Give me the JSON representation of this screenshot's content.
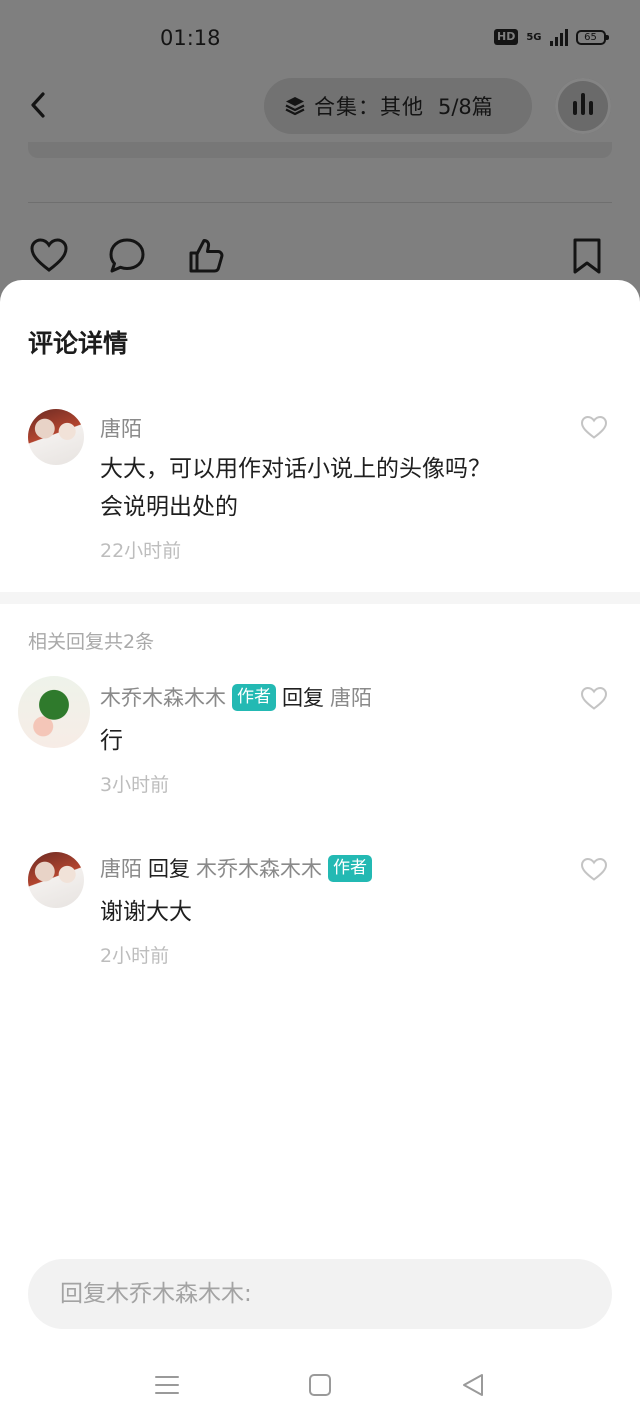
{
  "status_bar": {
    "time": "01:18",
    "hd": "HD",
    "network": "5G",
    "battery": "65"
  },
  "header": {
    "collection_label": "合集：其他",
    "collection_progress": "5/8篇"
  },
  "sheet": {
    "title": "评论详情",
    "main_comment": {
      "username": "唐陌",
      "text_line1": "大大，可以用作对话小说上的头像吗？",
      "text_line2": "会说明出处的",
      "time": "22小时前"
    },
    "replies_count": "相关回复共2条",
    "replies": [
      {
        "username": "木乔木森木木",
        "author_tag": "作者",
        "reply_word": "回复",
        "reply_to": "唐陌",
        "text": "行",
        "time": "3小时前"
      },
      {
        "username": "唐陌",
        "reply_word": "回复",
        "reply_to": "木乔木森木木",
        "author_tag": "作者",
        "text": "谢谢大大",
        "time": "2小时前"
      }
    ],
    "input_placeholder": "回复木乔木森木木:"
  },
  "colors": {
    "accent_tag": "#23b9b3",
    "overlay": "#7f7f7f"
  },
  "icons": [
    "chevron-left-icon",
    "layers-icon",
    "audio-icon",
    "heart-icon",
    "comment-icon",
    "like-icon",
    "bookmark-icon",
    "menu-icon",
    "home-icon",
    "back-icon"
  ]
}
